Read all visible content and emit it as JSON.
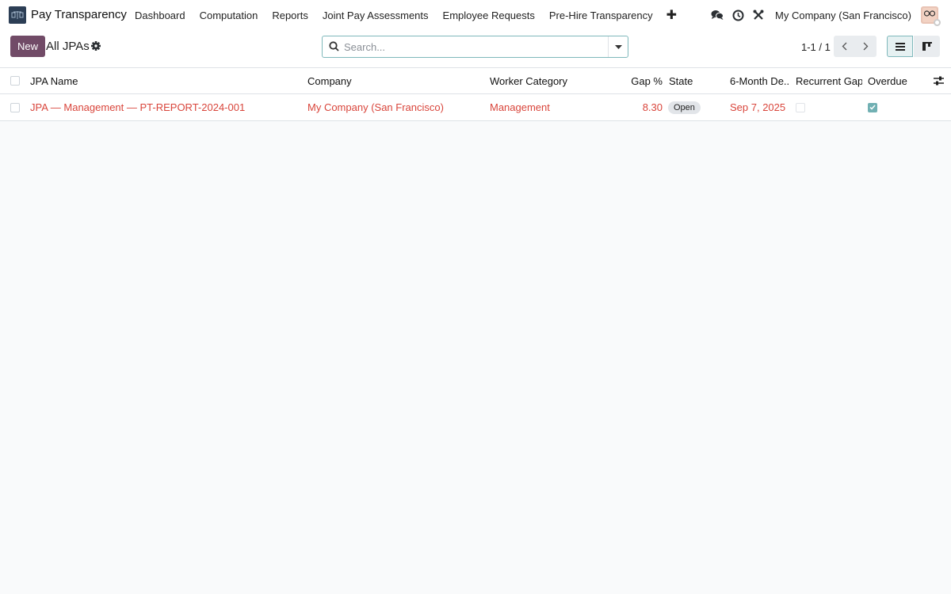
{
  "app": {
    "name": "Pay Transparency",
    "menu": [
      "Dashboard",
      "Computation",
      "Reports",
      "Joint Pay Assessments",
      "Employee Requests",
      "Pre-Hire Transparency"
    ],
    "add_menu_icon": "plus-icon",
    "company": "My Company (San Francisco)"
  },
  "control": {
    "new_label": "New",
    "title": "All JPAs",
    "search_placeholder": "Search...",
    "pager": "1-1 / 1"
  },
  "table": {
    "columns": [
      "JPA Name",
      "Company",
      "Worker Category",
      "Gap %",
      "State",
      "6-Month De...",
      "Recurrent Gap",
      "Overdue"
    ],
    "rows": [
      {
        "name": "JPA — Management — PT-REPORT-2024-001",
        "company": "My Company (San Francisco)",
        "category": "Management",
        "gap": "8.30",
        "state": "Open",
        "deadline": "Sep 7, 2025",
        "recurrent_gap": false,
        "overdue": true
      }
    ]
  },
  "colors": {
    "primary": "#714b67",
    "link_red": "#d9453b",
    "teal_accent": "#71b0b3",
    "brand_icon_bg": "#2c3e55"
  }
}
